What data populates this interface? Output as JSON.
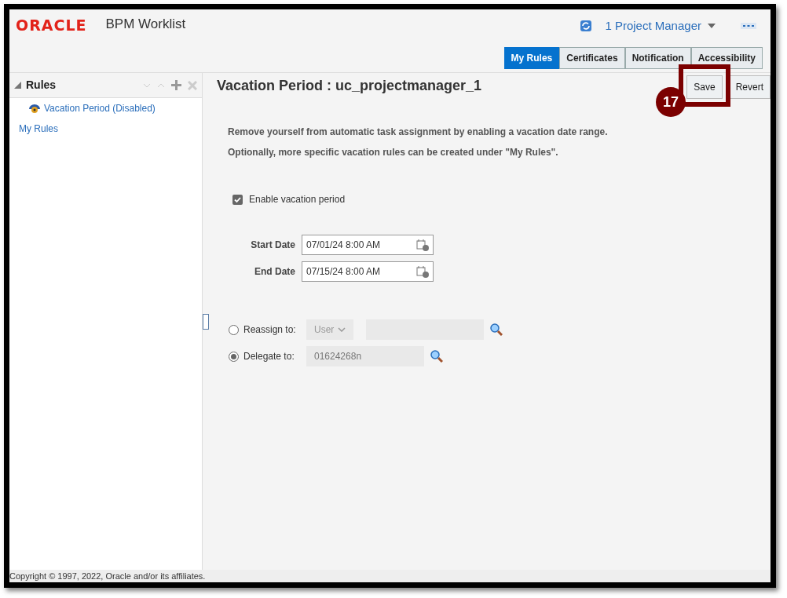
{
  "header": {
    "logo": "ORACLE",
    "app_title": "BPM Worklist",
    "user_menu": "1 Project Manager",
    "tabs": [
      {
        "label": "My Rules",
        "selected": true
      },
      {
        "label": "Certificates",
        "selected": false
      },
      {
        "label": "Notification",
        "selected": false
      },
      {
        "label": "Accessibility",
        "selected": false
      }
    ]
  },
  "sidebar": {
    "title": "Rules",
    "expanded": true,
    "items": [
      {
        "label": "Vacation Period (Disabled)",
        "kind": "vacation"
      },
      {
        "label": "My Rules",
        "kind": "plain"
      }
    ]
  },
  "content": {
    "title": "Vacation Period : uc_projectmanager_1",
    "buttons": [
      "Save",
      "Revert"
    ],
    "callout": {
      "number": "17"
    },
    "instructions": [
      "Remove yourself from automatic task assignment by enabling a vacation date range.",
      "Optionally, more specific vacation rules can be created under \"My Rules\"."
    ],
    "enable_vacation": {
      "label": "Enable vacation period",
      "checked": true
    },
    "dates": [
      {
        "label": "Start Date",
        "value": "07/01/24 8:00 AM"
      },
      {
        "label": "End Date",
        "value": "07/15/24 8:00 AM"
      }
    ],
    "assignments": [
      {
        "kind": "reassign",
        "label": "Reassign to:",
        "selected": false,
        "type_value": "User"
      },
      {
        "kind": "delegate",
        "label": "Delegate to:",
        "selected": true,
        "value": "01624268n"
      }
    ]
  },
  "footer": {
    "copyright": "Copyright © 1997, 2022, Oracle and/or its affiliates."
  }
}
